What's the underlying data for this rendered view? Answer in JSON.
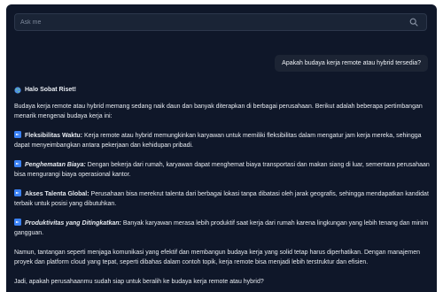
{
  "search": {
    "placeholder": "Ask me",
    "icon": "search-icon"
  },
  "user_message": "Apakah budaya kerja remote atau hybrid tersedia?",
  "answer": {
    "greeting": "Halo Sobat Riset!",
    "intro": "Budaya kerja remote atau hybrid memang sedang naik daun dan banyak diterapkan di berbagai perusahaan. Berikut adalah beberapa pertimbangan menarik mengenai budaya kerja ini:",
    "items": [
      {
        "label": "Fleksibilitas Waktu:",
        "style": "bold",
        "text": " Kerja remote atau hybrid memungkinkan karyawan untuk memiliki fleksibilitas dalam mengatur jam kerja mereka, sehingga dapat menyeimbangkan antara pekerjaan dan kehidupan pribadi."
      },
      {
        "label": "Penghematan Biaya:",
        "style": "bold-italic",
        "text": " Dengan bekerja dari rumah, karyawan dapat menghemat biaya transportasi dan makan siang di luar, sementara perusahaan bisa mengurangi biaya operasional kantor."
      },
      {
        "label": "Akses Talenta Global:",
        "style": "bold",
        "text": " Perusahaan bisa merekrut talenta dari berbagai lokasi tanpa dibatasi oleh jarak geografis, sehingga mendapatkan kandidat terbaik untuk posisi yang dibutuhkan."
      },
      {
        "label": "Produktivitas yang Ditingkatkan:",
        "style": "bold-italic",
        "text": " Banyak karyawan merasa lebih produktif saat kerja dari rumah karena lingkungan yang lebih tenang dan minim gangguan."
      }
    ],
    "closing": "Namun, tantangan seperti menjaga komunikasi yang efektif dan membangun budaya kerja yang solid tetap harus diperhatikan. Dengan manajemen proyek dan platform cloud yang tepat, seperti dibahas dalam contoh topik, kerja remote bisa menjadi lebih terstruktur dan efisien.",
    "question": "Jadi, apakah perusahaanmu sudah siap untuk beralih ke budaya kerja remote atau hybrid?"
  },
  "colors": {
    "background": "#0f1729",
    "bubble": "#1c2434",
    "accent": "#3b82f6"
  }
}
